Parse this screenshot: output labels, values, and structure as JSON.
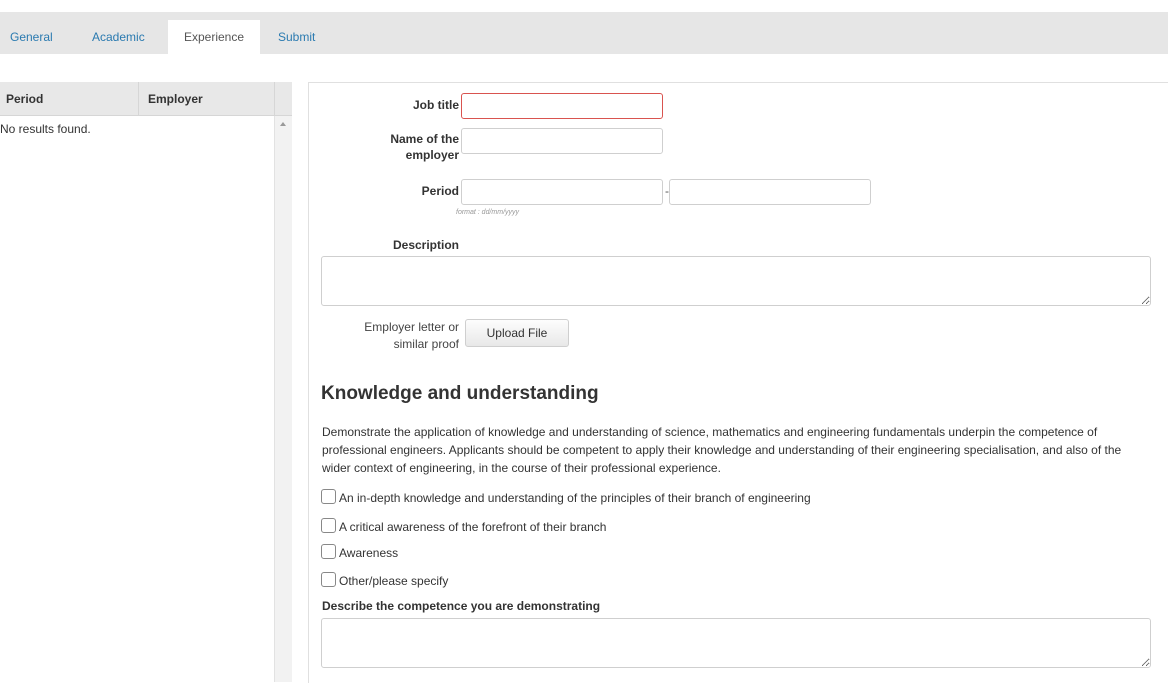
{
  "tabs": [
    {
      "label": "General"
    },
    {
      "label": "Academic"
    },
    {
      "label": "Experience"
    },
    {
      "label": "Submit"
    }
  ],
  "table": {
    "columns": [
      "Period",
      "Employer"
    ],
    "empty_text": "No results found."
  },
  "form": {
    "job_title_label": "Job title",
    "employer_label_line1": "Name of the",
    "employer_label_line2": "employer",
    "period_label": "Period",
    "period_separator": "-",
    "date_format_hint": "format : dd/mm/yyyy",
    "description_label": "Description",
    "upload_label_line1": "Employer letter or",
    "upload_label_line2": "similar proof",
    "upload_button": "Upload File"
  },
  "knowledge": {
    "title": "Knowledge and understanding",
    "paragraph": "Demonstrate the application of knowledge and understanding of science, mathematics and engineering fundamentals underpin the competence of professional engineers. Applicants should be competent to apply their knowledge and understanding of their engineering specialisation, and also of the wider context of engineering, in the course of their professional experience.",
    "options": [
      {
        "label": "An in-depth knowledge and understanding of the principles of their branch of engineering"
      },
      {
        "label": "A critical awareness of the forefront of their branch"
      },
      {
        "label": "Awareness"
      },
      {
        "label": "Other/please specify"
      }
    ],
    "describe_label": "Describe the competence you are demonstrating"
  }
}
